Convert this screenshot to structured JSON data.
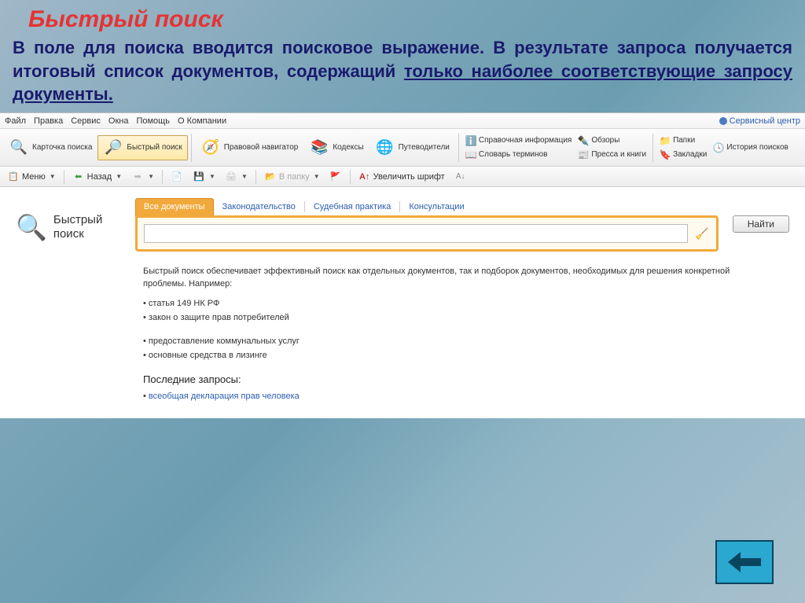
{
  "slide": {
    "title": "Быстрый поиск",
    "desc_part1": "В поле для поиска вводится поисковое выражение. В результате запроса получается итоговый список документов, содержащий ",
    "desc_underline": "только наиболее соответствующие запросу документы.",
    "desc_part2": ""
  },
  "menubar": {
    "items": [
      "Файл",
      "Правка",
      "Сервис",
      "Окна",
      "Помощь",
      "О Компании"
    ],
    "service_center": "Сервисный центр"
  },
  "toolbar1": {
    "search_card": "Карточка поиска",
    "quick_search": "Быстрый поиск",
    "legal_nav": "Правовой навигатор",
    "codexes": "Кодексы",
    "guides": "Путеводители",
    "col1": {
      "info": "Справочная информация",
      "dict": "Словарь терминов"
    },
    "col2": {
      "reviews": "Обзоры",
      "press": "Пресса и книги"
    },
    "col3": {
      "folders": "Папки",
      "bookmarks": "Закладки"
    },
    "col4": {
      "history": "История поисков"
    }
  },
  "toolbar2": {
    "menu": "Меню",
    "back": "Назад",
    "to_folder": "В папку",
    "increase_font": "Увеличить шрифт"
  },
  "search": {
    "label": "Быстрый поиск",
    "tabs": [
      "Все документы",
      "Законодательство",
      "Судебная практика",
      "Консультации"
    ],
    "input_value": "",
    "find": "Найти"
  },
  "hints": {
    "intro": "Быстрый поиск обеспечивает эффективный поиск как отдельных документов, так и подборок документов, необходимых для решения конкретной проблемы. Например:",
    "group1": [
      "статья 149 НК РФ",
      "закон о защите прав потребителей"
    ],
    "group2": [
      "предоставление коммунальных услуг",
      "основные средства в лизинге"
    ],
    "recent_title": "Последние запросы:",
    "recent_link": "всеобщая декларация прав человека"
  }
}
